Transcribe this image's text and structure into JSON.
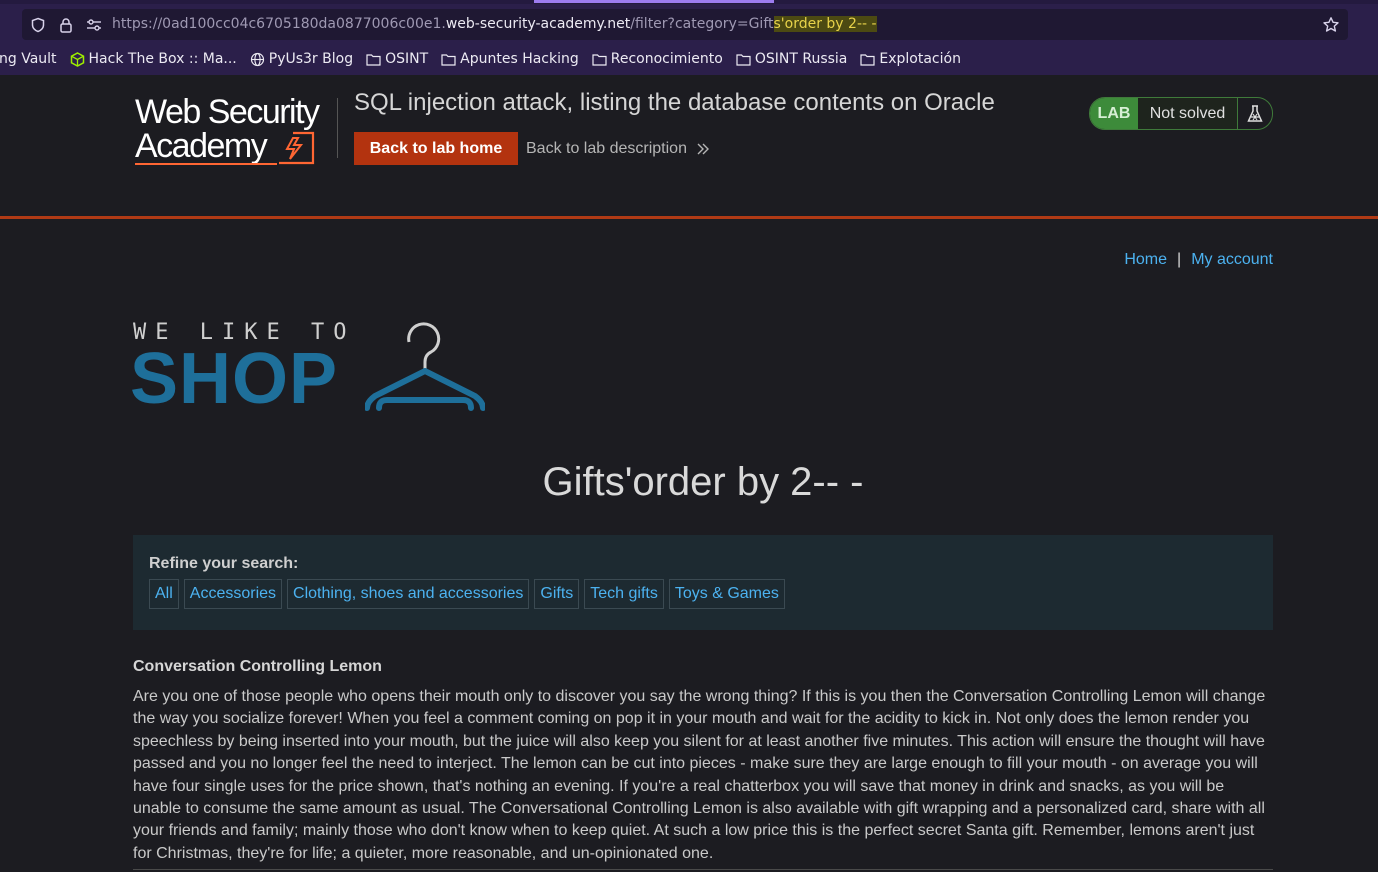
{
  "browser": {
    "url_prefix": "https://0ad100cc04c6705180da0877006c00e1.",
    "url_domain": "web-security-academy.net",
    "url_path": "/filter?category=Gift",
    "url_highlight": "s'order by 2-- -",
    "bookmarks": [
      {
        "label": "ng Vault",
        "icon": "none"
      },
      {
        "label": "Hack The Box :: Ma...",
        "icon": "htb-cube-icon"
      },
      {
        "label": "PyUs3r Blog",
        "icon": "globe-icon"
      },
      {
        "label": "OSINT",
        "icon": "folder-icon"
      },
      {
        "label": "Apuntes Hacking",
        "icon": "folder-icon"
      },
      {
        "label": "Reconocimiento",
        "icon": "folder-icon"
      },
      {
        "label": "OSINT Russia",
        "icon": "folder-icon"
      },
      {
        "label": "Explotación",
        "icon": "folder-icon"
      }
    ]
  },
  "academy": {
    "logo_line1": "Web Security",
    "logo_line2": "Academy",
    "lab_title": "SQL injection attack, listing the database contents on Oracle",
    "back_button": "Back to lab home",
    "description_link": "Back to lab description",
    "badge_lab": "LAB",
    "badge_status": "Not solved"
  },
  "shop": {
    "nav_home": "Home",
    "nav_sep": "|",
    "nav_account": "My account",
    "logo_small": "WE LIKE TO",
    "logo_big": "SHOP",
    "heading": "Gifts'order by 2-- -",
    "refine_label": "Refine your search:",
    "filters": [
      "All",
      "Accessories",
      "Clothing, shoes and accessories",
      "Gifts",
      "Tech gifts",
      "Toys & Games"
    ],
    "product": {
      "name": "Conversation Controlling Lemon",
      "description": "Are you one of those people who opens their mouth only to discover you say the wrong thing? If this is you then the Conversation Controlling Lemon will change the way you socialize forever! When you feel a comment coming on pop it in your mouth and wait for the acidity to kick in. Not only does the lemon render you speechless by being inserted into your mouth, but the juice will also keep you silent for at least another five minutes. This action will ensure the thought will have passed and you no longer feel the need to interject. The lemon can be cut into pieces - make sure they are large enough to fill your mouth - on average you will have four single uses for the price shown, that's nothing an evening. If you're a real chatterbox you will save that money in drink and snacks, as you will be unable to consume the same amount as usual. The Conversational Controlling Lemon is also available with gift wrapping and a personalized card, share with all your friends and family; mainly those who don't know when to keep quiet. At such a low price this is the perfect secret Santa gift. Remember, lemons aren't just for Christmas, they're for life; a quieter, more reasonable, and un-opinionated one."
    }
  },
  "colors": {
    "accent_orange": "#b3330f",
    "link_blue": "#4cb2f0",
    "lab_green": "#3d8b3a",
    "shop_logo_blue": "#1e6f9a"
  }
}
